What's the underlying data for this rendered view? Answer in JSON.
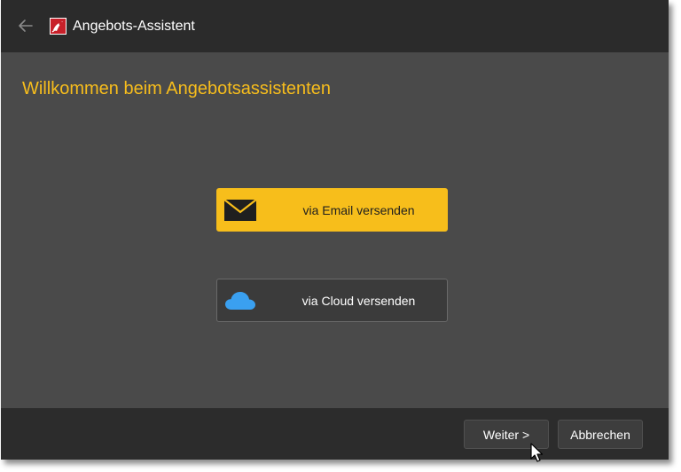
{
  "window": {
    "title": "Angebots-Assistent",
    "back_icon": "arrow-left-icon",
    "app_icon": "app-logo-icon"
  },
  "main": {
    "heading": "Willkommen beim Angebotsassistenten",
    "options": [
      {
        "label": "via Email versenden",
        "icon": "envelope-icon",
        "style": "primary"
      },
      {
        "label": "via Cloud versenden",
        "icon": "cloud-icon",
        "style": "secondary"
      }
    ]
  },
  "footer": {
    "next_label": "Weiter >",
    "cancel_label": "Abbrechen"
  },
  "colors": {
    "accent": "#f7be1b",
    "heading": "#f7bd1c",
    "cloud": "#3aa0f0",
    "titlebar": "#2b2b2b",
    "content_bg": "#4a4a4a"
  }
}
